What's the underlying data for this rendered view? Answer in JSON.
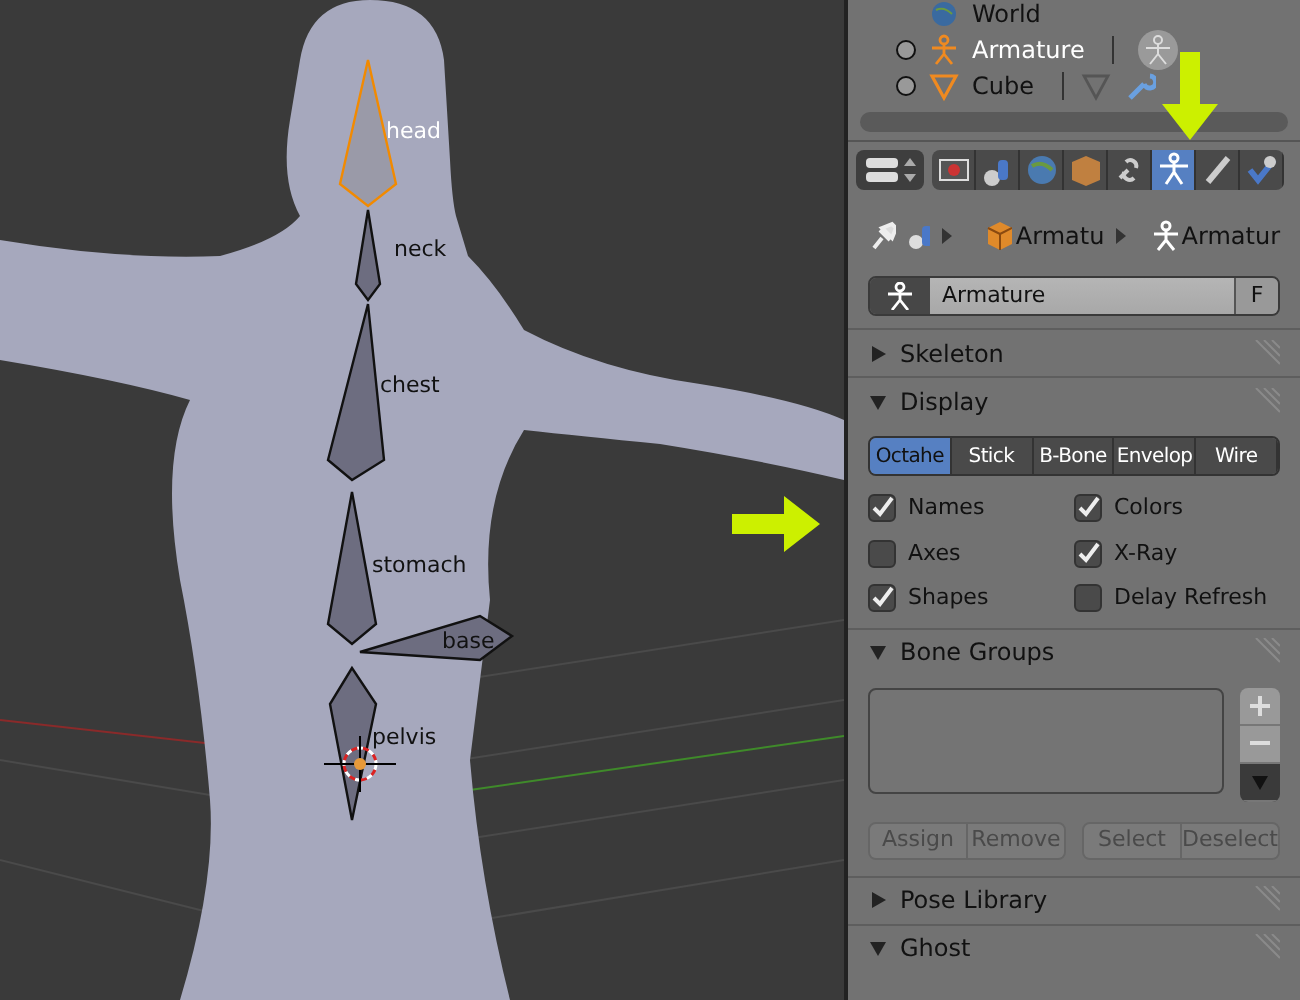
{
  "viewport": {
    "bones": [
      {
        "label": "head",
        "selected": true
      },
      {
        "label": "neck",
        "selected": false
      },
      {
        "label": "chest",
        "selected": false
      },
      {
        "label": "stomach",
        "selected": false
      },
      {
        "label": "base",
        "selected": false
      },
      {
        "label": "pelvis",
        "selected": false
      }
    ]
  },
  "outliner": {
    "rows": [
      {
        "label": "World"
      },
      {
        "label": "Armature"
      },
      {
        "label": "Cube"
      }
    ]
  },
  "properties_tabs": [
    {
      "selected": false
    },
    {
      "selected": false
    },
    {
      "selected": false
    },
    {
      "selected": false
    },
    {
      "selected": false
    },
    {
      "selected": true
    },
    {
      "selected": false
    },
    {
      "selected": false
    }
  ],
  "breadcrumb": [
    "Armatu",
    "Armatur"
  ],
  "name_field": {
    "value": "Armature",
    "fake_user": "F"
  },
  "skeleton_panel": {
    "title": "Skeleton",
    "expanded": false
  },
  "display_panel": {
    "title": "Display",
    "expanded": true,
    "draw_types": [
      {
        "label": "Octahe",
        "selected": true
      },
      {
        "label": "Stick",
        "selected": false
      },
      {
        "label": "B-Bone",
        "selected": false
      },
      {
        "label": "Envelop",
        "selected": false
      },
      {
        "label": "Wire",
        "selected": false
      }
    ],
    "options": [
      {
        "label": "Names",
        "checked": true
      },
      {
        "label": "Colors",
        "checked": true
      },
      {
        "label": "Axes",
        "checked": false
      },
      {
        "label": "X-Ray",
        "checked": true
      },
      {
        "label": "Shapes",
        "checked": true
      },
      {
        "label": "Delay Refresh",
        "checked": false
      }
    ]
  },
  "bone_groups_panel": {
    "title": "Bone Groups",
    "expanded": true,
    "buttons": [
      "Assign",
      "Remove",
      "Select",
      "Deselect"
    ]
  },
  "pose_library_panel": {
    "title": "Pose Library",
    "expanded": false
  },
  "ghost_panel": {
    "title": "Ghost",
    "expanded": true
  }
}
